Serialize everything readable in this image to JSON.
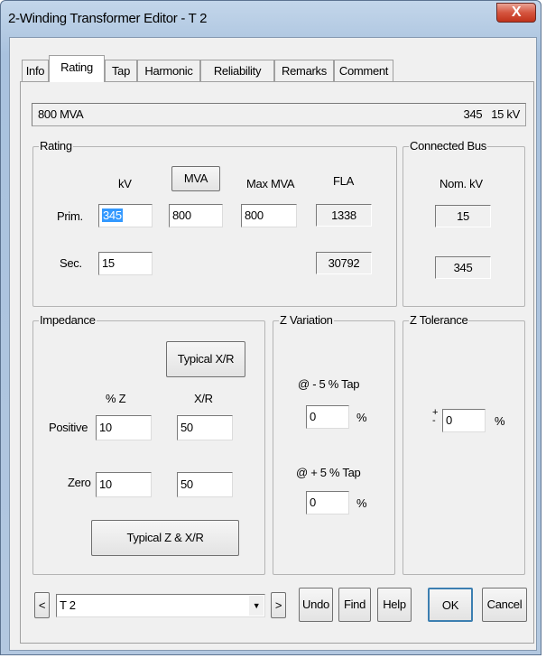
{
  "window": {
    "title": "2-Winding Transformer Editor - T 2",
    "close_glyph": "X"
  },
  "tabs": [
    {
      "label": "Info"
    },
    {
      "label": "Rating",
      "active": true
    },
    {
      "label": "Tap"
    },
    {
      "label": "Harmonic"
    },
    {
      "label": "Reliability"
    },
    {
      "label": "Remarks"
    },
    {
      "label": "Comment"
    }
  ],
  "header": {
    "rating": "800 MVA",
    "voltages": "345   15 kV"
  },
  "rating_group": {
    "legend": "Rating",
    "col_kv": "kV",
    "col_mva_button": "MVA",
    "col_max_mva": "Max MVA",
    "col_fla": "FLA",
    "prim_label": "Prim.",
    "sec_label": "Sec.",
    "prim_kv": "345",
    "prim_mva": "800",
    "prim_max_mva": "800",
    "prim_fla": "1338",
    "sec_kv": "15",
    "sec_fla": "30792"
  },
  "connected_bus": {
    "legend": "Connected Bus",
    "col_nom_kv": "Nom. kV",
    "prim_nom_kv": "15",
    "sec_nom_kv": "345"
  },
  "impedance": {
    "legend": "Impedance",
    "typical_xr_button": "Typical X/R",
    "col_pct_z": "% Z",
    "col_xr": "X/R",
    "positive_label": "Positive",
    "zero_label": "Zero",
    "positive_z": "10",
    "positive_xr": "50",
    "zero_z": "10",
    "zero_xr": "50",
    "typical_z_xr_button": "Typical Z & X/R"
  },
  "z_variation": {
    "legend": "Z Variation",
    "minus_tap_label": "@ - 5 % Tap",
    "minus_value": "0",
    "plus_tap_label": "@ + 5 % Tap",
    "plus_value": "0",
    "unit": "%"
  },
  "z_tolerance": {
    "legend": "Z Tolerance",
    "plus_minus": "+\n-",
    "value": "0",
    "unit": "%"
  },
  "footer": {
    "prev_label": "<",
    "next_label": ">",
    "selected_item": "T 2",
    "undo_label": "Undo",
    "find_label": "Find",
    "help_label": "Help",
    "ok_label": "OK",
    "cancel_label": "Cancel"
  }
}
